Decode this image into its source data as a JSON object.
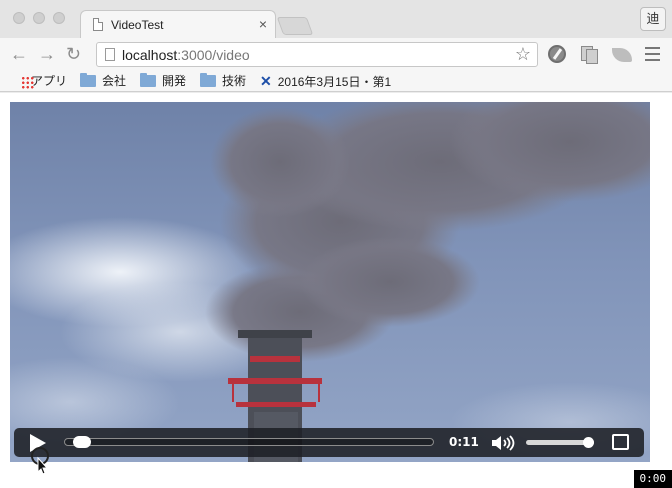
{
  "window": {
    "tab": {
      "title": "VideoTest",
      "close_glyph": "×"
    },
    "profile_button": "迪"
  },
  "toolbar": {
    "back_glyph": "←",
    "forward_glyph": "→",
    "reload_glyph": "↻",
    "url_host": "localhost",
    "url_rest": ":3000/video",
    "star_glyph": "☆"
  },
  "bookmarks": [
    {
      "label": "アプリ",
      "icon": "apps-grid-icon"
    },
    {
      "label": "会社",
      "icon": "folder-icon"
    },
    {
      "label": "開発",
      "icon": "folder-icon"
    },
    {
      "label": "技術",
      "icon": "folder-icon"
    },
    {
      "label": "2016年3月15日・第1",
      "icon": "x-logo-icon"
    }
  ],
  "video": {
    "description_colors": {
      "sky": "#7f93b9",
      "smoke": "#6c6c78",
      "chimney": "#4a4d56",
      "chimney_stripe": "#c0303a"
    },
    "controls": {
      "current_time": "0:11",
      "progress_fraction": 0.01,
      "volume_fraction": 1.0
    }
  },
  "overlay": {
    "timestamp": "0:00"
  }
}
